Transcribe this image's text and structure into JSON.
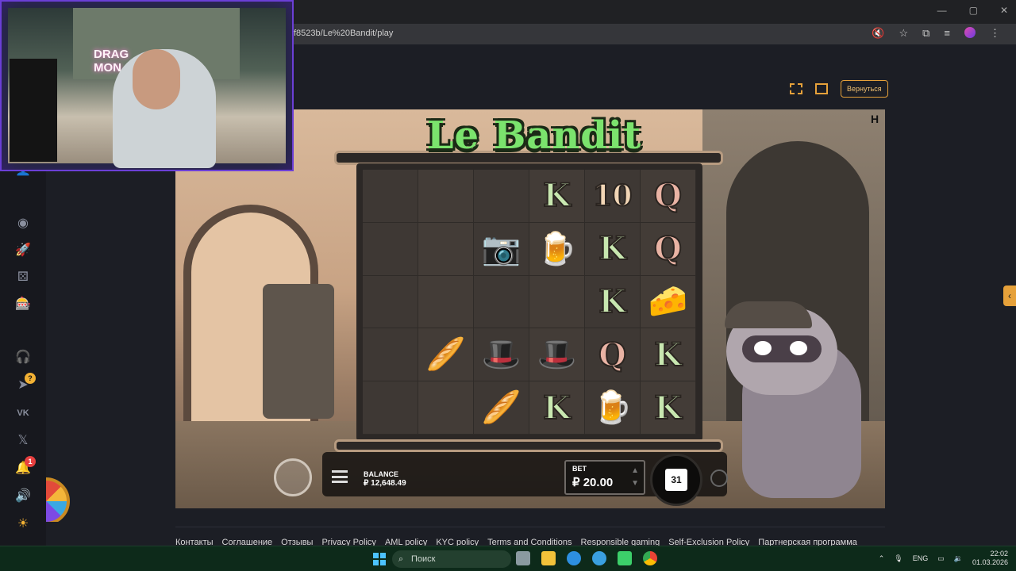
{
  "browser": {
    "url": "f8523b/Le%20Bandit/play",
    "window_controls": [
      "—",
      "▢",
      "✕"
    ],
    "icons": [
      "mute-icon",
      "star-icon",
      "extensions-icon",
      "media-icon",
      "profile-avatar",
      "menu-icon"
    ]
  },
  "header": {
    "back_label": "Вернуться",
    "icons": [
      "fullscreen-icon",
      "theater-mode-icon"
    ]
  },
  "sidebar": {
    "items": [
      {
        "icon": "user-icon"
      },
      {
        "icon": "poker-chip-icon"
      },
      {
        "icon": "rocket-icon"
      },
      {
        "icon": "dice-icon"
      },
      {
        "icon": "slot-icon"
      },
      {
        "icon": "support-icon"
      },
      {
        "icon": "telegram-icon",
        "badge": "?"
      },
      {
        "icon": "vk-icon"
      },
      {
        "icon": "x-icon"
      },
      {
        "icon": "bell-icon",
        "badge": "1"
      },
      {
        "icon": "sound-icon"
      },
      {
        "icon": "sun-icon"
      }
    ]
  },
  "game": {
    "title": "Le Bandit",
    "reels": [
      [
        "",
        "",
        "",
        "",
        ""
      ],
      [
        "",
        "",
        "",
        "bread",
        ""
      ],
      [
        "",
        "camera",
        "",
        "hat",
        "bread"
      ],
      [
        "K",
        "beer",
        "",
        "hat",
        "K"
      ],
      [
        "10",
        "K",
        "K",
        "Q",
        "beer"
      ],
      [
        "Q",
        "Q",
        "cheese",
        "K",
        "K"
      ]
    ],
    "symbol_glyphs": {
      "camera": "📷",
      "beer": "🍺",
      "cheese": "🧀",
      "hat": "🎩",
      "bread": "🥖"
    },
    "balance_label": "BALANCE",
    "balance_value": "₽ 12,648.49",
    "bet_label": "BET",
    "bet_value": "₽ 20.00",
    "spins_count": "31",
    "hud_icons": [
      "bonus-buy-icon",
      "hamburger-menu-icon",
      "bet-up-icon",
      "bet-down-icon",
      "autoplay-icon"
    ]
  },
  "footer": {
    "links": [
      "Контакты",
      "Соглашение",
      "Отзывы",
      "Privacy Policy",
      "AML policy",
      "KYC policy",
      "Terms and Conditions",
      "Responsible gaming",
      "Self-Exclusion Policy",
      "Партнерская программа"
    ]
  },
  "webcam": {
    "sign_text_line1": "DRAG",
    "sign_text_line2": "MON"
  },
  "taskbar": {
    "search_placeholder": "Поиск",
    "language": "ENG",
    "time": "22:02",
    "date": "01.03.2026",
    "apps": [
      "widgets-icon",
      "task-view-icon",
      "file-explorer-icon",
      "edge-icon",
      "telegram-icon",
      "app-icon",
      "chrome-icon"
    ],
    "colors": {
      "accent": "#4cc2ff",
      "taskbar_bg": "#0d2a1a"
    }
  },
  "colors": {
    "accent": "#e6a13a",
    "logo_green": "#7be36d"
  }
}
